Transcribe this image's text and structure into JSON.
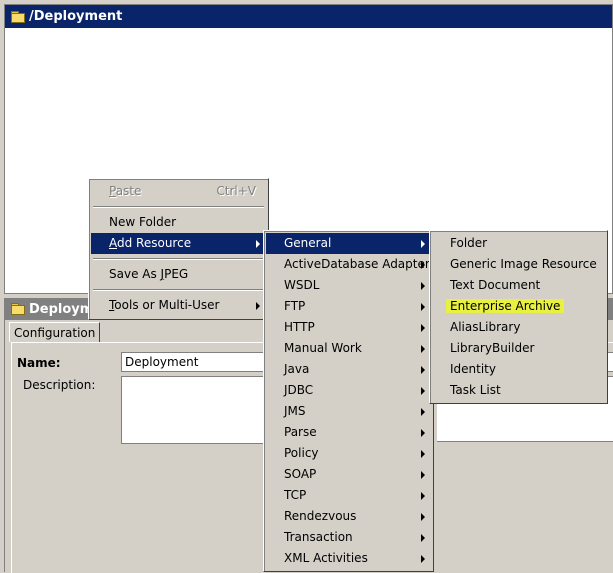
{
  "top_panel": {
    "title": "/Deployment"
  },
  "bottom_panel": {
    "title": "Deploym",
    "tab": "Configuration",
    "name_label": "Name:",
    "name_value": "Deployment",
    "description_label": "Description:"
  },
  "context_menu": {
    "paste": {
      "pre": "",
      "u": "P",
      "post": "aste",
      "shortcut": "Ctrl+V"
    },
    "new_folder": "New Folder",
    "add_resource": {
      "pre": "",
      "u": "A",
      "post": "dd Resource"
    },
    "save_as_jpeg": {
      "pre": "Save As ",
      "u": "J",
      "post": "PEG"
    },
    "tools": {
      "pre": "",
      "u": "T",
      "post": "ools or Multi-User"
    }
  },
  "resource_menu": {
    "items": [
      "General",
      "ActiveDatabase Adapter",
      "WSDL",
      "FTP",
      "HTTP",
      "Manual Work",
      "Java",
      "JDBC",
      "JMS",
      "Parse",
      "Policy",
      "SOAP",
      "TCP",
      "Rendezvous",
      "Transaction",
      "XML Activities"
    ]
  },
  "general_menu": {
    "items": [
      "Folder",
      "Generic Image Resource",
      "Text Document",
      "Enterprise Archive",
      "AliasLibrary",
      "LibraryBuilder",
      "Identity",
      "Task List"
    ]
  }
}
